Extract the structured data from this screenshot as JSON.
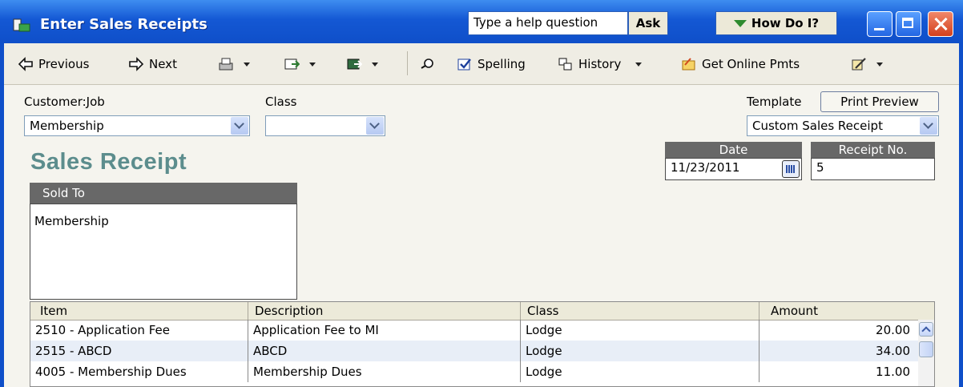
{
  "window": {
    "title": "Enter Sales Receipts",
    "help_placeholder": "Type a help question",
    "ask_label": "Ask",
    "howdoi_label": "How Do I?"
  },
  "toolbar": {
    "previous": "Previous",
    "next": "Next",
    "spelling": "Spelling",
    "history": "History",
    "get_online_pmts": "Get Online Pmts"
  },
  "form": {
    "customer_job_label": "Customer:Job",
    "customer_job_value": "Membership",
    "class_label": "Class",
    "class_value": "",
    "template_label": "Template",
    "print_preview": "Print Preview",
    "template_value": "Custom Sales Receipt",
    "heading": "Sales Receipt",
    "date_label": "Date",
    "date_value": "11/23/2011",
    "receipt_no_label": "Receipt No.",
    "receipt_no_value": "5",
    "sold_to_label": "Sold To",
    "sold_to_value": "Membership"
  },
  "table": {
    "columns": [
      "Item",
      "Description",
      "Class",
      "Amount"
    ],
    "rows": [
      {
        "item": "2510 - Application Fee",
        "description": "Application Fee to MI",
        "class": "Lodge",
        "amount": "20.00"
      },
      {
        "item": "2515 - ABCD",
        "description": "ABCD",
        "class": "Lodge",
        "amount": "34.00"
      },
      {
        "item": "4005 - Membership Dues",
        "description": "Membership Dues",
        "class": "Lodge",
        "amount": "11.00"
      }
    ]
  },
  "colors": {
    "title_bar": "#1458d4",
    "heading": "#5c8d8d",
    "header_box": "#686868"
  }
}
